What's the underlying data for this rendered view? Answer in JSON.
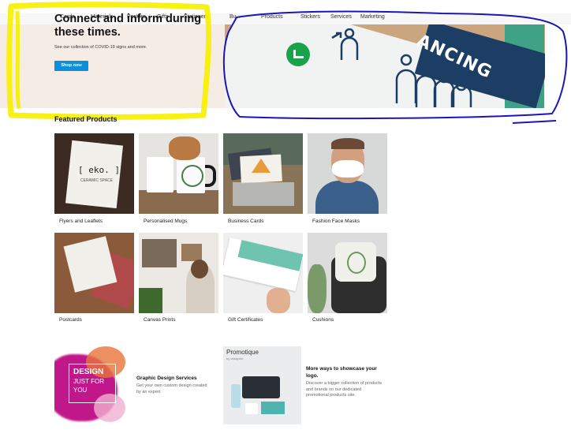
{
  "nav": {
    "items": [
      "Cards",
      "Materials",
      "Posters",
      "Gifts",
      "Stationery",
      "Bu",
      "Products",
      "Stickers",
      "Services",
      "Marketing"
    ]
  },
  "hero": {
    "title": "Connect and inform during these times.",
    "subtitle": "See our collection of COVID-19 signs and more.",
    "button": "Shop now",
    "sign_text": "ANCING",
    "colors": {
      "button": "#0a8fdc",
      "sign_navy": "#1d3e64",
      "check_green": "#17a24b"
    }
  },
  "featured": {
    "title": "Featured Products",
    "products": [
      {
        "label": "Flyers and Leaflets",
        "card_text": "[ eko. ]",
        "card_sub": "CERAMIC SPACE"
      },
      {
        "label": "Personalised Mugs"
      },
      {
        "label": "Business Cards"
      },
      {
        "label": "Fashion Face Masks"
      },
      {
        "label": "Postcards"
      },
      {
        "label": "Canvas Prints"
      },
      {
        "label": "Gift Certificates"
      },
      {
        "label": "Cushions"
      }
    ]
  },
  "promos": [
    {
      "image_text_line1": "DESIGN",
      "image_text_line2": "JUST FOR",
      "image_text_line3": "YOU",
      "title": "Graphic Design Services",
      "description": "Get your own custom design created by an expert."
    },
    {
      "brand": "Promotique",
      "brand_sub": "by vistaprint",
      "title": "More ways to showcase your logo.",
      "description": "Discover a bigger collection of products and brands on our dedicated promotional products site."
    }
  ],
  "annotation_colors": {
    "yellow": "#f6f000",
    "blue": "#1a17b8"
  }
}
